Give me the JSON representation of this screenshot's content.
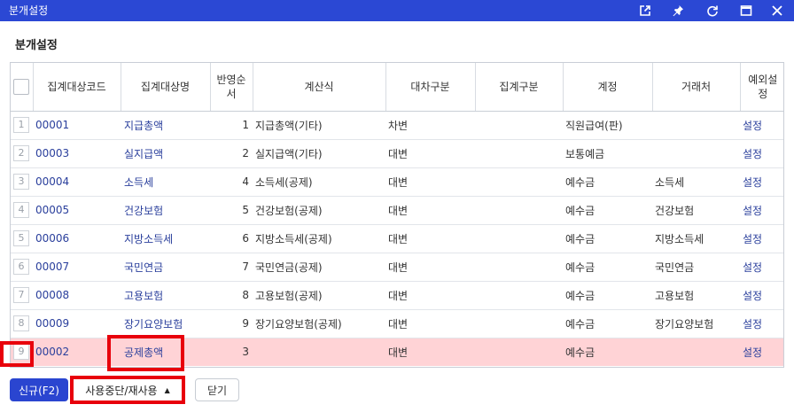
{
  "window": {
    "title": "분개설정",
    "icons": [
      "external-link-icon",
      "pin-icon",
      "refresh-icon",
      "maximize-icon",
      "close-icon"
    ]
  },
  "page": {
    "title": "분개설정"
  },
  "grid": {
    "headers": {
      "code": "집계대상코드",
      "name": "집계대상명",
      "order": "반영순서",
      "formula": "계산식",
      "debit_credit": "대차구분",
      "agg_type": "집계구분",
      "account": "계정",
      "client": "거래처",
      "exception": "예외설정"
    },
    "rows": [
      {
        "num": "1",
        "code": "00001",
        "name": "지급총액",
        "order": "1",
        "formula": "지급총액(기타)",
        "dc": "차변",
        "agg": "",
        "account": "직원급여(판)",
        "client": "",
        "exception": "설정"
      },
      {
        "num": "2",
        "code": "00003",
        "name": "실지급액",
        "order": "2",
        "formula": "실지급액(기타)",
        "dc": "대변",
        "agg": "",
        "account": "보통예금",
        "client": "",
        "exception": "설정"
      },
      {
        "num": "3",
        "code": "00004",
        "name": "소득세",
        "order": "4",
        "formula": "소득세(공제)",
        "dc": "대변",
        "agg": "",
        "account": "예수금",
        "client": "소득세",
        "exception": "설정"
      },
      {
        "num": "4",
        "code": "00005",
        "name": "건강보험",
        "order": "5",
        "formula": "건강보험(공제)",
        "dc": "대변",
        "agg": "",
        "account": "예수금",
        "client": "건강보험",
        "exception": "설정"
      },
      {
        "num": "5",
        "code": "00006",
        "name": "지방소득세",
        "order": "6",
        "formula": "지방소득세(공제)",
        "dc": "대변",
        "agg": "",
        "account": "예수금",
        "client": "지방소득세",
        "exception": "설정"
      },
      {
        "num": "6",
        "code": "00007",
        "name": "국민연금",
        "order": "7",
        "formula": "국민연금(공제)",
        "dc": "대변",
        "agg": "",
        "account": "예수금",
        "client": "국민연금",
        "exception": "설정"
      },
      {
        "num": "7",
        "code": "00008",
        "name": "고용보험",
        "order": "8",
        "formula": "고용보험(공제)",
        "dc": "대변",
        "agg": "",
        "account": "예수금",
        "client": "고용보험",
        "exception": "설정"
      },
      {
        "num": "8",
        "code": "00009",
        "name": "장기요양보험",
        "order": "9",
        "formula": "장기요양보험(공제)",
        "dc": "대변",
        "agg": "",
        "account": "예수금",
        "client": "장기요양보험",
        "exception": "설정"
      },
      {
        "num": "9",
        "code": "00002",
        "name": "공제총액",
        "order": "3",
        "formula": "",
        "dc": "대변",
        "agg": "",
        "account": "예수금",
        "client": "",
        "exception": "설정"
      }
    ]
  },
  "buttons": {
    "new": "신규(F2)",
    "status": "사용중단/재사용",
    "close": "닫기"
  },
  "colors": {
    "titlebar": "#2b48d4",
    "primary_button": "#2a45d0",
    "selected_row": "#ffd3d6",
    "highlight": "#e8000b",
    "link": "#2a3f9c"
  }
}
